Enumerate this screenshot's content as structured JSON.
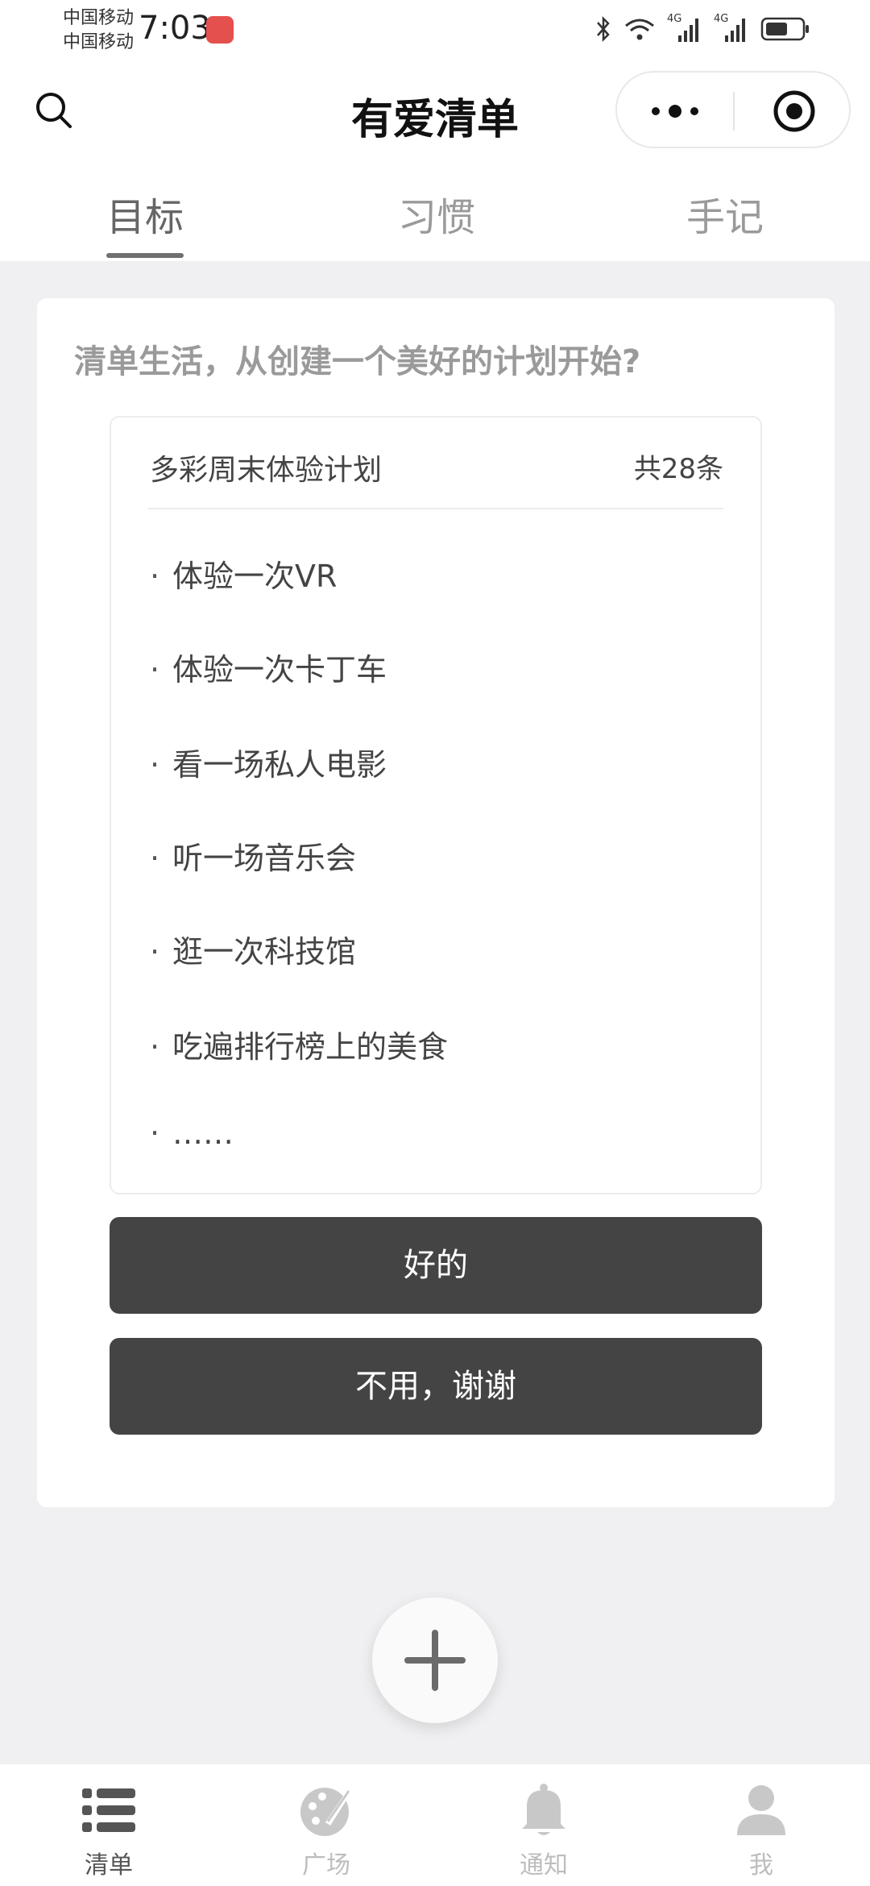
{
  "status_bar": {
    "carrier1": "中国移动",
    "carrier2": "中国移动",
    "time": "7:03",
    "network1": "4G",
    "network2": "4G"
  },
  "header": {
    "title": "有爱清单",
    "icons": [
      "search-icon",
      "more-dots-icon",
      "close-target-icon"
    ]
  },
  "tabs": [
    {
      "label": "目标",
      "active": true
    },
    {
      "label": "习惯",
      "active": false
    },
    {
      "label": "手记",
      "active": false
    }
  ],
  "card": {
    "prompt": "清单生活，从创建一个美好的计划开始?",
    "plan": {
      "title": "多彩周末体验计划",
      "count": "共28条",
      "items": [
        "体验一次VR",
        "体验一次卡丁车",
        "看一场私人电影",
        "听一场音乐会",
        "逛一次科技馆",
        "吃遍排行榜上的美食",
        "……"
      ]
    },
    "ok_label": "好的",
    "no_label": "不用，谢谢"
  },
  "bottom_nav": [
    {
      "label": "清单",
      "icon": "list-icon",
      "active": true
    },
    {
      "label": "广场",
      "icon": "palette-icon",
      "active": false
    },
    {
      "label": "通知",
      "icon": "bell-icon",
      "active": false
    },
    {
      "label": "我",
      "icon": "person-icon",
      "active": false
    }
  ],
  "colors": {
    "accent_button": "#444444",
    "page_background": "#f0f0f2",
    "inactive": "#bdbdbd"
  }
}
